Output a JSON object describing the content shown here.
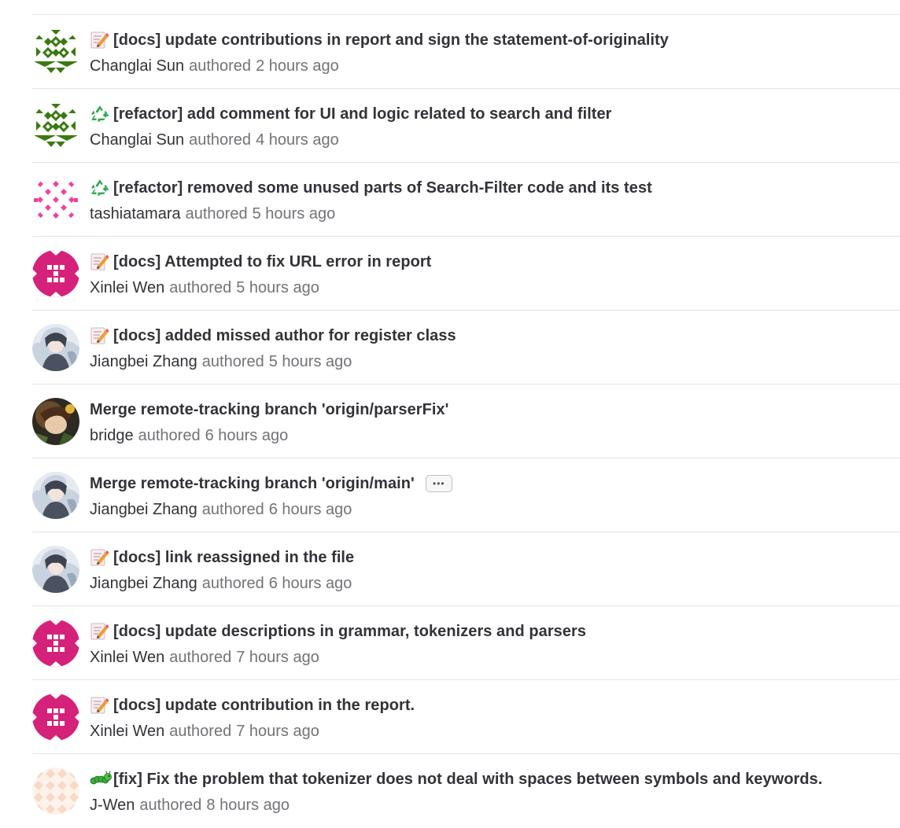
{
  "commits": [
    {
      "emoji": "memo-icon",
      "title": "[docs] update contributions in report and sign the statement-of-originality",
      "author": "Changlai Sun",
      "authored": "authored",
      "time": "2 hours ago",
      "avatar": "identicon-green"
    },
    {
      "emoji": "recycle-icon",
      "title": "[refactor] add comment for UI and logic related to search and filter",
      "author": "Changlai Sun",
      "authored": "authored",
      "time": "4 hours ago",
      "avatar": "identicon-green"
    },
    {
      "emoji": "recycle-icon",
      "title": "[refactor] removed some unused parts of Search-Filter code and its test",
      "author": "tashiatamara",
      "authored": "authored",
      "time": "5 hours ago",
      "avatar": "identicon-pink-dots"
    },
    {
      "emoji": "memo-icon",
      "title": "[docs] Attempted to fix URL error in report",
      "author": "Xinlei Wen",
      "authored": "authored",
      "time": "5 hours ago",
      "avatar": "identicon-magenta"
    },
    {
      "emoji": "memo-icon",
      "title": "[docs] added missed author for register class",
      "author": "Jiangbei Zhang",
      "authored": "authored",
      "time": "5 hours ago",
      "avatar": "photo-avatar"
    },
    {
      "emoji": "",
      "title": "Merge remote-tracking branch 'origin/parserFix'",
      "author": "bridge",
      "authored": "authored",
      "time": "6 hours ago",
      "avatar": "photo-avatar-dark"
    },
    {
      "emoji": "",
      "title": "Merge remote-tracking branch 'origin/main'",
      "author": "Jiangbei Zhang",
      "authored": "authored",
      "time": "6 hours ago",
      "avatar": "photo-avatar",
      "has_more": true,
      "more_label": "•••"
    },
    {
      "emoji": "memo-icon",
      "title": "[docs] link reassigned in the file",
      "author": "Jiangbei Zhang",
      "authored": "authored",
      "time": "6 hours ago",
      "avatar": "photo-avatar"
    },
    {
      "emoji": "memo-icon",
      "title": "[docs] update descriptions in grammar, tokenizers and parsers",
      "author": "Xinlei Wen",
      "authored": "authored",
      "time": "7 hours ago",
      "avatar": "identicon-magenta"
    },
    {
      "emoji": "memo-icon",
      "title": "[docs] update contribution in the report.",
      "author": "Xinlei Wen",
      "authored": "authored",
      "time": "7 hours ago",
      "avatar": "identicon-magenta"
    },
    {
      "emoji": "caterpillar-icon",
      "title": "[fix] Fix the problem that tokenizer does not deal with spaces between symbols and keywords.",
      "author": "J-Wen",
      "authored": "authored",
      "time": "8 hours ago",
      "avatar": "identicon-peach"
    }
  ],
  "colors": {
    "identicon_green": "#3a7a12",
    "identicon_pink": "#f0449a",
    "identicon_magenta": "#d6217a",
    "identicon_peach": "#f7d9c4",
    "divider": "#e4e4e7",
    "text_primary": "#333238",
    "text_secondary": "#737278"
  }
}
